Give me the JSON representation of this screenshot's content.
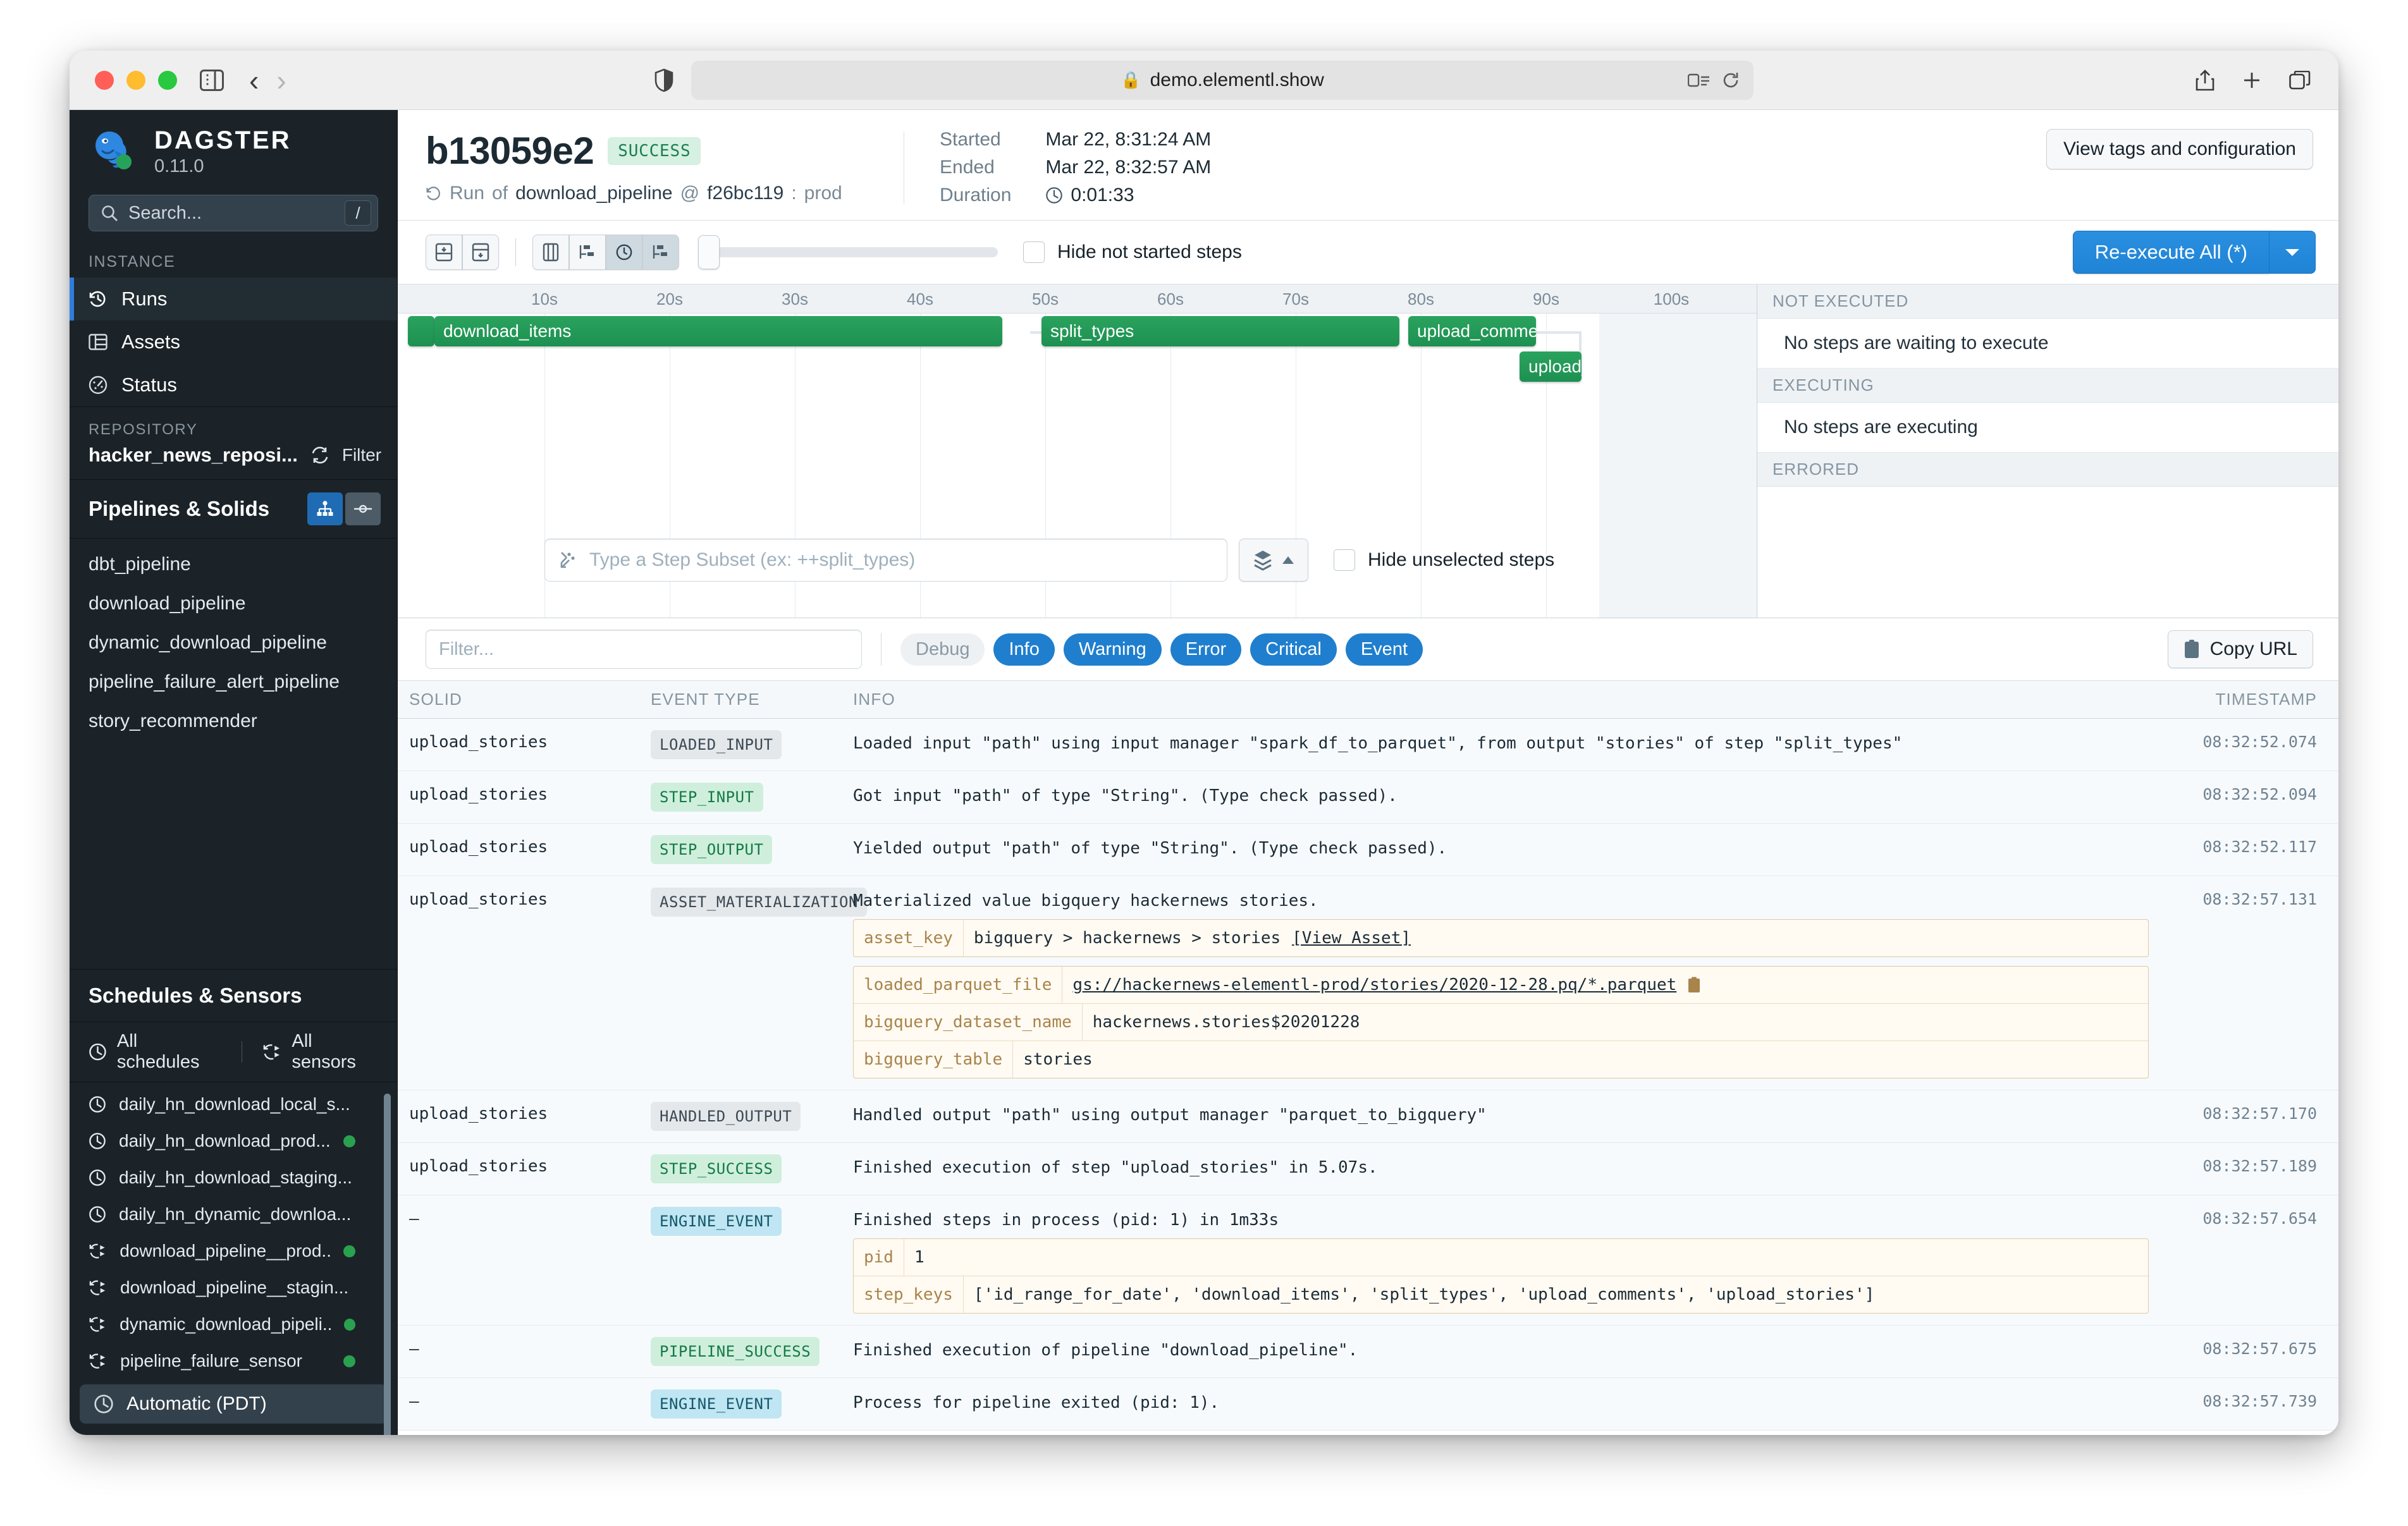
{
  "browser": {
    "url": "demo.elementl.show",
    "lock_icon": "lock-icon",
    "shield_icon": "shield-icon",
    "sidebar_toggle_icon": "sidebar-toggle-icon",
    "back_icon": "back-arrow-icon",
    "forward_icon": "forward-arrow-icon",
    "reader_icon": "reader-mode-icon",
    "reload_icon": "reload-icon",
    "share_icon": "share-icon",
    "newtab_icon": "new-tab-icon",
    "tabs_icon": "show-tabs-icon"
  },
  "sidebar": {
    "brand": {
      "name": "DAGSTER",
      "version": "0.11.0"
    },
    "search": {
      "placeholder": "Search...",
      "shortcut": "/"
    },
    "instance_label": "INSTANCE",
    "instance_items": [
      {
        "label": "Runs",
        "icon": "history-clock-icon",
        "active": true
      },
      {
        "label": "Assets",
        "icon": "table-icon",
        "active": false
      },
      {
        "label": "Status",
        "icon": "gauge-icon",
        "active": false
      }
    ],
    "repository_label": "REPOSITORY",
    "repository_name": "hacker_news_reposi...",
    "repository_reload_icon": "reload-icon",
    "repository_filter": "Filter",
    "pipelines_title": "Pipelines & Solids",
    "pipelines_toggle_graph_icon": "graph-view-icon",
    "pipelines_toggle_solid_icon": "solid-view-icon",
    "pipelines": [
      "dbt_pipeline",
      "download_pipeline",
      "dynamic_download_pipeline",
      "pipeline_failure_alert_pipeline",
      "story_recommender"
    ],
    "schedules_title": "Schedules & Sensors",
    "all_schedules": "All schedules",
    "all_sensors": "All sensors",
    "schedule_items": [
      {
        "label": "daily_hn_download_local_s...",
        "icon": "clock-icon",
        "status": false
      },
      {
        "label": "daily_hn_download_prod...",
        "icon": "clock-icon",
        "status": true
      },
      {
        "label": "daily_hn_download_staging...",
        "icon": "clock-icon",
        "status": false
      },
      {
        "label": "daily_hn_dynamic_downloa...",
        "icon": "clock-icon",
        "status": false
      },
      {
        "label": "download_pipeline__prod...",
        "icon": "sensor-icon",
        "status": true
      },
      {
        "label": "download_pipeline__stagin...",
        "icon": "sensor-icon",
        "status": false
      },
      {
        "label": "dynamic_download_pipeli...",
        "icon": "sensor-icon",
        "status": true
      },
      {
        "label": "pipeline_failure_sensor",
        "icon": "sensor-icon",
        "status": true
      }
    ],
    "timezone": "Automatic (PDT)",
    "timezone_icon": "clock-icon"
  },
  "run_header": {
    "run_id": "b13059e2",
    "status_badge": "SUCCESS",
    "subtitle_prefix": "Run",
    "subtitle_of": "of",
    "pipeline_name": "download_pipeline",
    "at_symbol": "@",
    "snapshot": "f26bc119",
    "mode": "prod",
    "rerun_icon": "rerun-icon",
    "labels": {
      "started": "Started",
      "ended": "Ended",
      "duration": "Duration"
    },
    "started": "Mar 22, 8:31:24 AM",
    "ended": "Mar 22, 8:32:57 AM",
    "duration": "0:01:33",
    "duration_icon": "clock-icon",
    "view_tags_button": "View tags and configuration"
  },
  "gantt_toolbar": {
    "expand_icon": "expand-all-icon",
    "collapse_icon": "collapse-all-icon",
    "view_grid_icon": "columns-view-icon",
    "view_waterfall_icon": "waterfall-view-icon",
    "view_time_icon": "time-view-icon",
    "view_tree_icon": "tree-view-icon",
    "hide_not_started_label": "Hide not started steps",
    "reexecute_label": "Re-execute All (*)",
    "reexecute_caret_icon": "chevron-down-icon"
  },
  "gantt": {
    "ticks": [
      "10s",
      "20s",
      "30s",
      "40s",
      "50s",
      "60s",
      "70s",
      "80s",
      "90s",
      "100s"
    ],
    "bars": [
      {
        "label": "",
        "start_s": 0,
        "end_s": 1.2,
        "row": 0
      },
      {
        "label": "download_items",
        "start_s": 1.5,
        "end_s": 46.5,
        "row": 0
      },
      {
        "label": "split_types",
        "start_s": 49.0,
        "end_s": 77.5,
        "row": 0
      },
      {
        "label": "upload_comment",
        "start_s": 78.5,
        "end_s": 87.5,
        "row": 0
      },
      {
        "label": "upload_",
        "start_s": 88.5,
        "end_s": 93.0,
        "row": 1
      }
    ],
    "subset_placeholder": "Type a Step Subset (ex: ++split_types)",
    "subset_icon": "step-subset-icon",
    "layers_icon": "layers-icon",
    "layers_caret_icon": "caret-up-icon",
    "hide_unselected_label": "Hide unselected steps"
  },
  "status_panel": {
    "sections": [
      {
        "title": "NOT EXECUTED",
        "message": "No steps are waiting to execute"
      },
      {
        "title": "EXECUTING",
        "message": "No steps are executing"
      },
      {
        "title": "ERRORED",
        "message": ""
      }
    ]
  },
  "log_filter": {
    "placeholder": "Filter...",
    "levels": [
      {
        "label": "Debug",
        "on": false
      },
      {
        "label": "Info",
        "on": true
      },
      {
        "label": "Warning",
        "on": true
      },
      {
        "label": "Error",
        "on": true
      },
      {
        "label": "Critical",
        "on": true
      },
      {
        "label": "Event",
        "on": true
      }
    ],
    "copy_url_label": "Copy URL",
    "copy_icon": "clipboard-icon"
  },
  "log_table": {
    "columns": [
      "SOLID",
      "EVENT TYPE",
      "INFO",
      "TIMESTAMP"
    ],
    "rows": [
      {
        "solid": "upload_stories",
        "event_type": "LOADED_INPUT",
        "tag_color": "grey",
        "info": "Loaded input \"path\" using input manager \"spark_df_to_parquet\", from output \"stories\" of step \"split_types\"",
        "timestamp": "08:32:52.074"
      },
      {
        "solid": "upload_stories",
        "event_type": "STEP_INPUT",
        "tag_color": "green",
        "info": "Got input \"path\" of type \"String\". (Type check passed).",
        "timestamp": "08:32:52.094"
      },
      {
        "solid": "upload_stories",
        "event_type": "STEP_OUTPUT",
        "tag_color": "green",
        "info": "Yielded output \"path\" of type \"String\". (Type check passed).",
        "timestamp": "08:32:52.117"
      },
      {
        "solid": "upload_stories",
        "event_type": "ASSET_MATERIALIZATION",
        "tag_color": "grey",
        "info": "Materialized value bigquery hackernews stories.",
        "timestamp": "08:32:57.131",
        "metadata": [
          {
            "key": "asset_key",
            "value": "bigquery > hackernews > stories",
            "link": "[View Asset]"
          },
          {
            "key": "loaded_parquet_file",
            "value": "gs://hackernews-elementl-prod/stories/2020-12-28.pq/*.parquet",
            "underline": true,
            "copy": true
          },
          {
            "key": "bigquery_dataset_name",
            "value": "hackernews.stories$20201228"
          },
          {
            "key": "bigquery_table",
            "value": "stories"
          }
        ]
      },
      {
        "solid": "upload_stories",
        "event_type": "HANDLED_OUTPUT",
        "tag_color": "grey",
        "info": "Handled output \"path\" using output manager \"parquet_to_bigquery\"",
        "timestamp": "08:32:57.170"
      },
      {
        "solid": "upload_stories",
        "event_type": "STEP_SUCCESS",
        "tag_color": "green",
        "info": "Finished execution of step \"upload_stories\" in 5.07s.",
        "timestamp": "08:32:57.189"
      },
      {
        "solid": "–",
        "event_type": "ENGINE_EVENT",
        "tag_color": "blue",
        "info": "Finished steps in process (pid: 1) in 1m33s",
        "timestamp": "08:32:57.654",
        "metadata": [
          {
            "key": "pid",
            "value": "1"
          },
          {
            "key": "step_keys",
            "value": "['id_range_for_date', 'download_items', 'split_types', 'upload_comments', 'upload_stories']"
          }
        ]
      },
      {
        "solid": "–",
        "event_type": "PIPELINE_SUCCESS",
        "tag_color": "green",
        "info": "Finished execution of pipeline \"download_pipeline\".",
        "timestamp": "08:32:57.675"
      },
      {
        "solid": "–",
        "event_type": "ENGINE_EVENT",
        "tag_color": "blue",
        "info": "Process for pipeline exited (pid: 1).",
        "timestamp": "08:32:57.739"
      }
    ]
  },
  "colors": {
    "accent_blue": "#1f7fce",
    "success_green": "#1d9051",
    "sidebar_bg": "#1b2329",
    "badge_green_bg": "#d6f0e2"
  }
}
